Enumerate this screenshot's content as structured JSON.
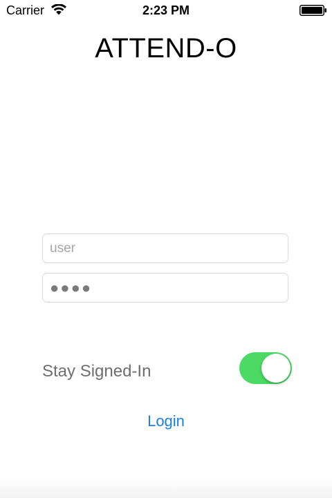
{
  "status_bar": {
    "carrier": "Carrier",
    "time": "2:23 PM",
    "wifi_icon": "wifi-icon",
    "battery_icon": "battery-full-icon"
  },
  "app": {
    "title": "ATTEND-O"
  },
  "login_form": {
    "user_placeholder": "user",
    "user_value": "",
    "password_value": "●●●●",
    "stay_signed_in_label": "Stay Signed-In",
    "stay_signed_in_on": true,
    "login_label": "Login"
  },
  "colors": {
    "accent": "#1a7fe8",
    "toggle_on": "#4cd964"
  }
}
